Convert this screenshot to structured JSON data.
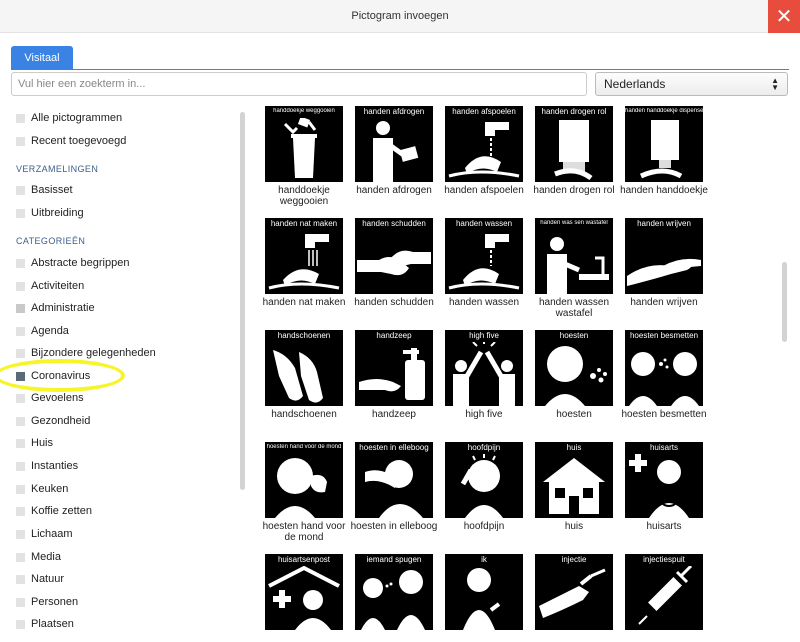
{
  "window": {
    "title": "Pictogram invoegen",
    "close_label": "✕"
  },
  "tabs": [
    {
      "label": "Visitaal",
      "active": true
    }
  ],
  "search": {
    "placeholder": "Vul hier een zoekterm in...",
    "value": ""
  },
  "language": {
    "selected": "Nederlands"
  },
  "sidebar": {
    "top_items": [
      {
        "label": "Alle pictogrammen"
      },
      {
        "label": "Recent toegevoegd"
      }
    ],
    "collections_heading": "VERZAMELINGEN",
    "collections": [
      {
        "label": "Basisset"
      },
      {
        "label": "Uitbreiding"
      }
    ],
    "categories_heading": "CATEGORIEËN",
    "categories": [
      {
        "label": "Abstracte begrippen"
      },
      {
        "label": "Activiteiten"
      },
      {
        "label": "Administratie"
      },
      {
        "label": "Agenda"
      },
      {
        "label": "Bijzondere gelegenheden"
      },
      {
        "label": "Coronavirus",
        "selected": true
      },
      {
        "label": "Gevoelens"
      },
      {
        "label": "Gezondheid"
      },
      {
        "label": "Huis"
      },
      {
        "label": "Instanties"
      },
      {
        "label": "Keuken"
      },
      {
        "label": "Koffie zetten"
      },
      {
        "label": "Lichaam"
      },
      {
        "label": "Media"
      },
      {
        "label": "Natuur"
      },
      {
        "label": "Personen"
      },
      {
        "label": "Plaatsen"
      }
    ]
  },
  "pictograms": [
    {
      "tile_label": "handdoekje weggooien",
      "caption": "handdoekje weggooien",
      "icon": "towel-bin-icon"
    },
    {
      "tile_label": "handen afdrogen",
      "caption": "handen afdrogen",
      "icon": "drying-hands-icon"
    },
    {
      "tile_label": "handen afspoelen",
      "caption": "handen afspoelen",
      "icon": "rinsing-hands-icon"
    },
    {
      "tile_label": "handen drogen rol",
      "caption": "handen drogen rol",
      "icon": "towel-roll-icon"
    },
    {
      "tile_label": "handen handdoekje dispenser",
      "caption": "handen handdoekje",
      "icon": "towel-dispenser-icon"
    },
    {
      "tile_label": "handen nat maken",
      "caption": "handen nat maken",
      "icon": "wetting-hands-icon"
    },
    {
      "tile_label": "handen schudden",
      "caption": "handen schudden",
      "icon": "handshake-icon"
    },
    {
      "tile_label": "handen wassen",
      "caption": "handen wassen",
      "icon": "washing-hands-icon"
    },
    {
      "tile_label": "handen was sen wastafel",
      "caption": "handen wassen wastafel",
      "icon": "sink-icon"
    },
    {
      "tile_label": "handen wrijven",
      "caption": "handen wrijven",
      "icon": "rubbing-hands-icon"
    },
    {
      "tile_label": "handschoenen",
      "caption": "handschoenen",
      "icon": "gloves-icon"
    },
    {
      "tile_label": "handzeep",
      "caption": "handzeep",
      "icon": "soap-icon"
    },
    {
      "tile_label": "high five",
      "caption": "high five",
      "icon": "high-five-icon"
    },
    {
      "tile_label": "hoesten",
      "caption": "hoesten",
      "icon": "coughing-icon"
    },
    {
      "tile_label": "hoesten besmetten",
      "caption": "hoesten besmetten",
      "icon": "cough-infect-icon"
    },
    {
      "tile_label": "hoesten hand voor de mond",
      "caption": "hoesten hand voor de mond",
      "icon": "cough-hand-icon"
    },
    {
      "tile_label": "hoesten in elleboog",
      "caption": "hoesten in elleboog",
      "icon": "cough-elbow-icon"
    },
    {
      "tile_label": "hoofdpijn",
      "caption": "hoofdpijn",
      "icon": "headache-icon"
    },
    {
      "tile_label": "huis",
      "caption": "huis",
      "icon": "house-icon"
    },
    {
      "tile_label": "huisarts",
      "caption": "huisarts",
      "icon": "doctor-icon"
    },
    {
      "tile_label": "huisartsenpost",
      "caption": "",
      "icon": "doctor-post-icon"
    },
    {
      "tile_label": "iemand spugen",
      "caption": "",
      "icon": "spitting-icon"
    },
    {
      "tile_label": "ik",
      "caption": "",
      "icon": "me-icon"
    },
    {
      "tile_label": "injectie",
      "caption": "",
      "icon": "injection-icon"
    },
    {
      "tile_label": "injectiespuit",
      "caption": "",
      "icon": "syringe-icon"
    }
  ]
}
